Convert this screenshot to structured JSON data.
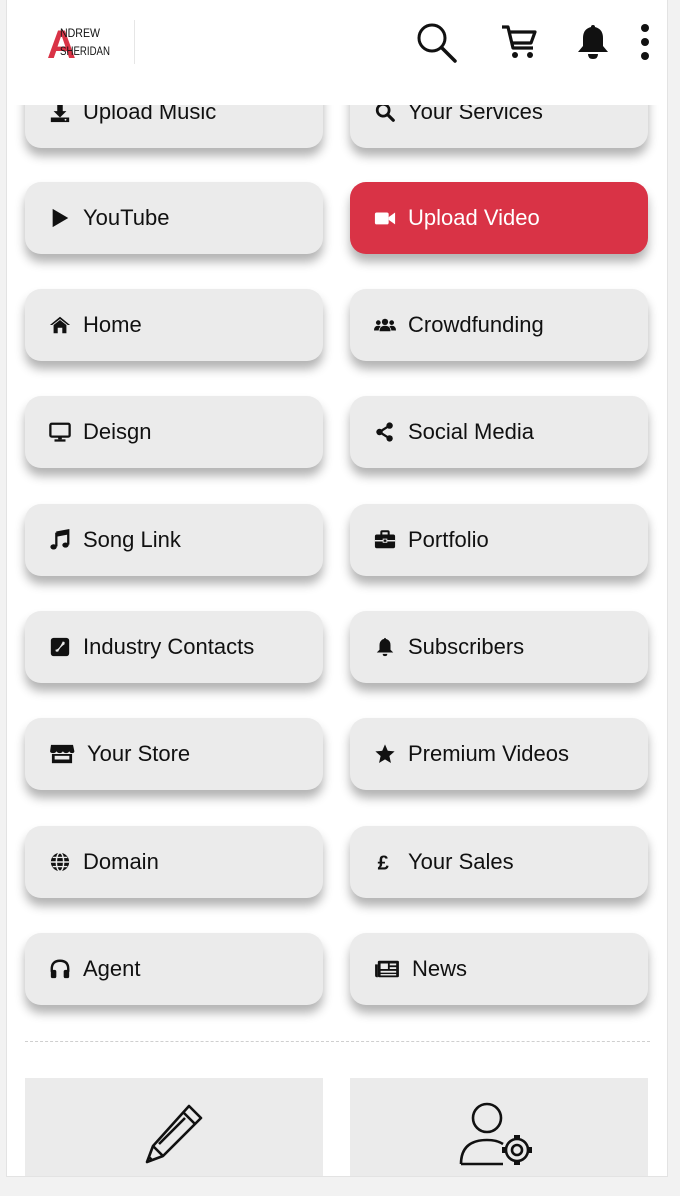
{
  "header": {
    "logo_line1": "NDREW",
    "logo_line2": "SHERIDAN",
    "logo_initial": "A",
    "icons": [
      "search-icon",
      "cart-icon",
      "bell-icon",
      "more-vertical-icon"
    ]
  },
  "colors": {
    "accent": "#d93346",
    "tile": "#ebebeb"
  },
  "menu": [
    {
      "label": "Upload Music",
      "icon": "upload-icon"
    },
    {
      "label": "Your Services",
      "icon": "search-icon"
    },
    {
      "label": "YouTube",
      "icon": "play-icon"
    },
    {
      "label": "Upload Video",
      "icon": "video-camera-icon",
      "active": true
    },
    {
      "label": "Home",
      "icon": "home-icon"
    },
    {
      "label": "Crowdfunding",
      "icon": "users-icon"
    },
    {
      "label": "Deisgn",
      "icon": "desktop-icon"
    },
    {
      "label": "Social Media",
      "icon": "share-icon"
    },
    {
      "label": "Song Link",
      "icon": "music-note-icon"
    },
    {
      "label": "Portfolio",
      "icon": "briefcase-icon"
    },
    {
      "label": "Industry Contacts",
      "icon": "phone-square-icon"
    },
    {
      "label": "Subscribers",
      "icon": "bell-icon"
    },
    {
      "label": "Your Store",
      "icon": "store-icon"
    },
    {
      "label": "Premium Videos",
      "icon": "star-icon"
    },
    {
      "label": "Domain",
      "icon": "globe-icon"
    },
    {
      "label": "Your Sales",
      "icon": "pound-icon"
    },
    {
      "label": "Agent",
      "icon": "headphones-icon"
    },
    {
      "label": "News",
      "icon": "newspaper-icon"
    }
  ],
  "bottom_cards": [
    {
      "icon": "pencil-icon"
    },
    {
      "icon": "user-settings-icon"
    }
  ]
}
